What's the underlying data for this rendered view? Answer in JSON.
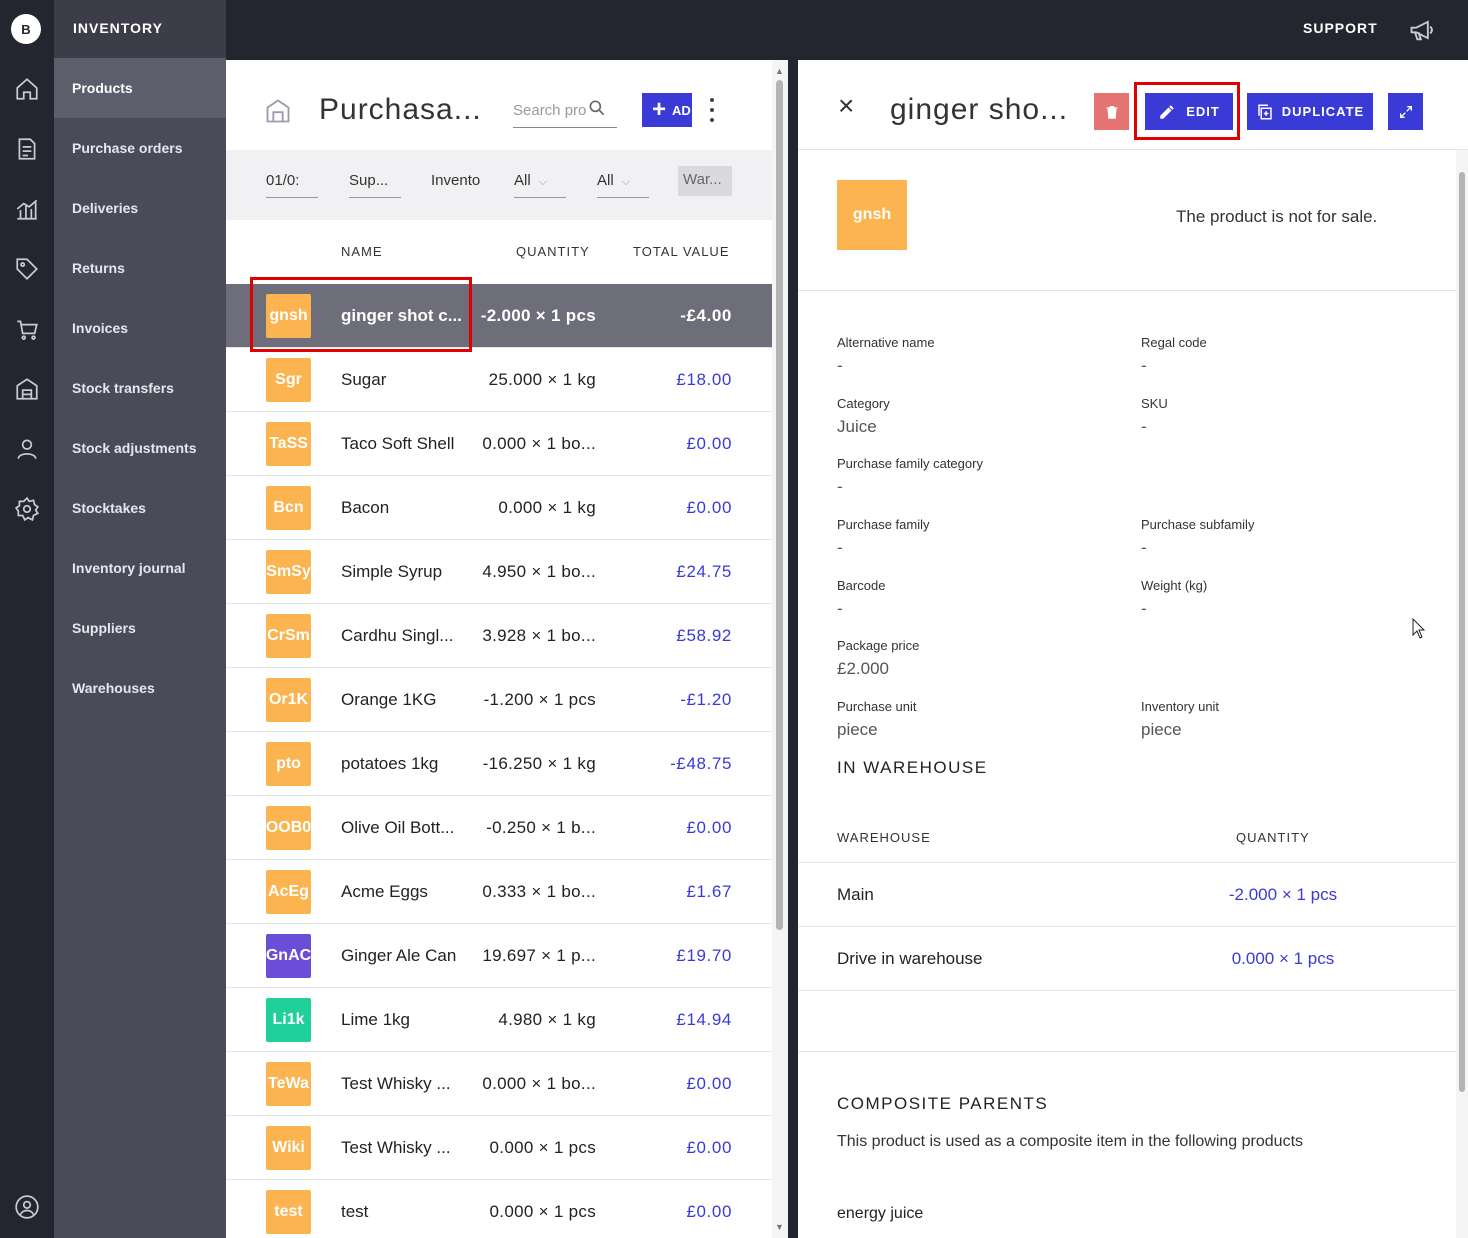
{
  "app": {
    "logo": "B",
    "section_title": "INVENTORY",
    "support_label": "SUPPORT"
  },
  "rail_icons": [
    "home-icon",
    "document-icon",
    "chart-icon",
    "tag-icon",
    "cart-icon",
    "warehouse-icon",
    "user-icon",
    "settings-icon"
  ],
  "nav": {
    "items": [
      {
        "label": "Products",
        "active": true
      },
      {
        "label": "Purchase orders"
      },
      {
        "label": "Deliveries"
      },
      {
        "label": "Returns"
      },
      {
        "label": "Invoices"
      },
      {
        "label": "Stock transfers"
      },
      {
        "label": "Stock adjustments"
      },
      {
        "label": "Stocktakes"
      },
      {
        "label": "Inventory journal"
      },
      {
        "label": "Suppliers"
      },
      {
        "label": "Warehouses"
      }
    ]
  },
  "list": {
    "title": "Purchasa...",
    "search_placeholder": "Search pro",
    "add_label": "AD",
    "filters": {
      "date": "01/0:",
      "supplier": "Sup...",
      "inventory": "Invento",
      "all1": "All",
      "all2": "All",
      "warehouse": "War..."
    },
    "columns": {
      "name": "NAME",
      "quantity": "QUANTITY",
      "total": "TOTAL VALUE"
    },
    "rows": [
      {
        "badge": "gnsh",
        "color": "#fbb450",
        "name": "ginger shot c...",
        "qty": "-2.000 × 1 pcs",
        "total": "-£4.00",
        "selected": true
      },
      {
        "badge": "Sgr",
        "color": "#fbb450",
        "name": "Sugar",
        "qty": "25.000 × 1 kg",
        "total": "£18.00"
      },
      {
        "badge": "TaSS",
        "color": "#fbb450",
        "name": "Taco Soft Shell",
        "qty": "0.000 × 1 bo...",
        "total": "£0.00"
      },
      {
        "badge": "Bcn",
        "color": "#fbb450",
        "name": "Bacon",
        "qty": "0.000 × 1 kg",
        "total": "£0.00"
      },
      {
        "badge": "SmSy",
        "color": "#fbb450",
        "name": "Simple Syrup",
        "qty": "4.950 × 1 bo...",
        "total": "£24.75"
      },
      {
        "badge": "CrSm",
        "color": "#fbb450",
        "name": "Cardhu Singl...",
        "qty": "3.928 × 1 bo...",
        "total": "£58.92"
      },
      {
        "badge": "Or1K",
        "color": "#fbb450",
        "name": "Orange 1KG",
        "qty": "-1.200 × 1 pcs",
        "total": "-£1.20"
      },
      {
        "badge": "pto",
        "color": "#fbb450",
        "name": "potatoes 1kg",
        "qty": "-16.250 × 1 kg",
        "total": "-£48.75"
      },
      {
        "badge": "OOB0",
        "color": "#fbb450",
        "name": "Olive Oil Bott...",
        "qty": "-0.250 × 1 b...",
        "total": "£0.00"
      },
      {
        "badge": "AcEg",
        "color": "#fbb450",
        "name": "Acme Eggs",
        "qty": "0.333 × 1 bo...",
        "total": "£1.67"
      },
      {
        "badge": "GnAC",
        "color": "#6b4ed8",
        "name": "Ginger Ale Can",
        "qty": "19.697 × 1 p...",
        "total": "£19.70"
      },
      {
        "badge": "Li1k",
        "color": "#20d09a",
        "name": "Lime 1kg",
        "qty": "4.980 × 1 kg",
        "total": "£14.94"
      },
      {
        "badge": "TeWa",
        "color": "#fbb450",
        "name": "Test Whisky ...",
        "qty": "0.000 × 1 bo...",
        "total": "£0.00"
      },
      {
        "badge": "Wiki",
        "color": "#fbb450",
        "name": "Test Whisky ...",
        "qty": "0.000 × 1 pcs",
        "total": "£0.00"
      },
      {
        "badge": "test",
        "color": "#fbb450",
        "name": "test",
        "qty": "0.000 × 1 pcs",
        "total": "£0.00"
      }
    ]
  },
  "detail": {
    "title": "ginger sho...",
    "edit_label": "EDIT",
    "duplicate_label": "DUPLICATE",
    "badge": "gnsh",
    "not_for_sale": "The product is not for sale.",
    "fields": {
      "alt_name_label": "Alternative name",
      "alt_name": "-",
      "regal_label": "Regal code",
      "regal": "-",
      "category_label": "Category",
      "category": "Juice",
      "sku_label": "SKU",
      "sku": "-",
      "pfc_label": "Purchase family category",
      "pfc": "-",
      "pf_label": "Purchase family",
      "pf": "-",
      "psf_label": "Purchase subfamily",
      "psf": "-",
      "barcode_label": "Barcode",
      "barcode": "-",
      "weight_label": "Weight (kg)",
      "weight": "-",
      "pkg_price_label": "Package price",
      "pkg_price": "£2.000",
      "pu_label": "Purchase unit",
      "pu": "piece",
      "iu_label": "Inventory unit",
      "iu": "piece"
    },
    "in_warehouse_heading": "IN WAREHOUSE",
    "warehouse_col": "WAREHOUSE",
    "quantity_col": "QUANTITY",
    "warehouses": [
      {
        "name": "Main",
        "qty": "-2.000 × 1 pcs"
      },
      {
        "name": "Drive in warehouse",
        "qty": "0.000 × 1 pcs"
      }
    ],
    "composite_heading": "COMPOSITE PARENTS",
    "composite_desc": "This product is used as a composite item in the following products",
    "composite_item": "energy juice"
  },
  "colors": {
    "accent": "#3a3ad6",
    "danger": "#e57373",
    "badge": "#fbb450",
    "highlight": "#e00000"
  }
}
